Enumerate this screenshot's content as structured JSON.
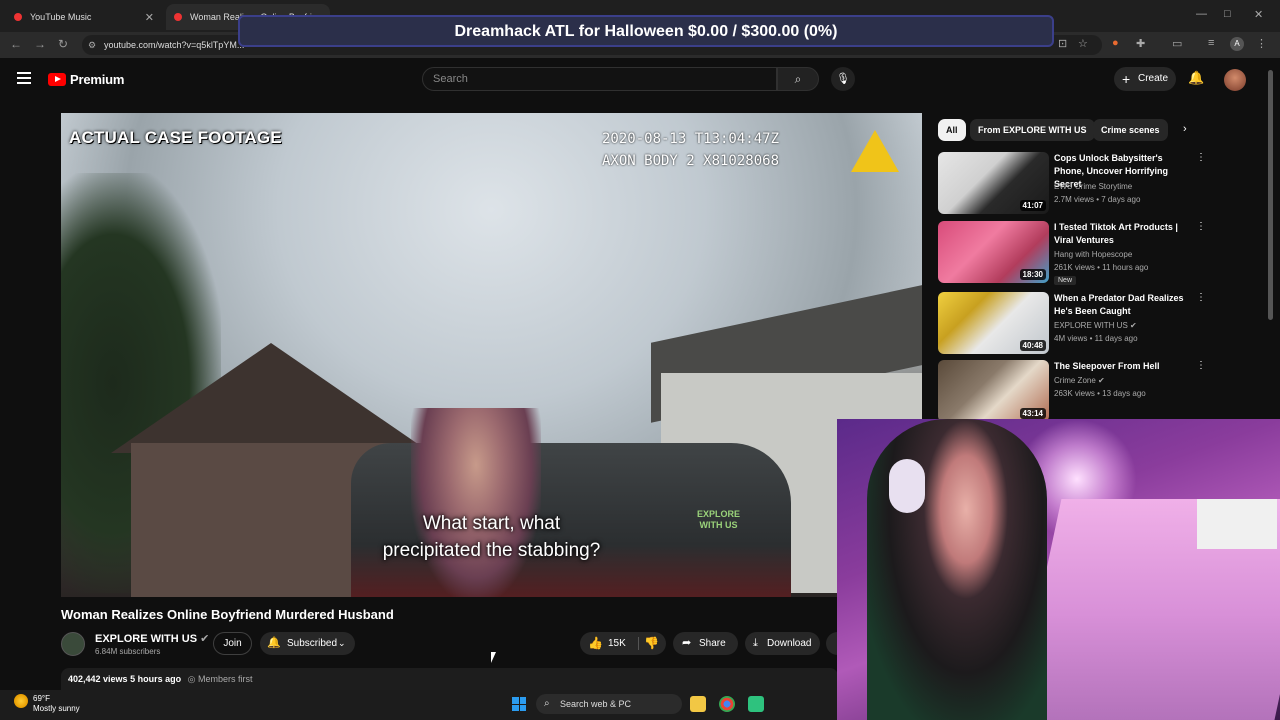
{
  "browser": {
    "tabs": [
      {
        "label": "YouTube Music"
      },
      {
        "label": "Woman Realizes Online Boyfriend Murdered Husband"
      }
    ],
    "url": "youtube.com/watch?v=q5klTpYM..."
  },
  "overlay_banner": "Dreamhack ATL for Halloween $0.00 / $300.00 (0%)",
  "yt": {
    "logo_text": "Premium",
    "search_placeholder": "Search",
    "create_label": "Create"
  },
  "player": {
    "corner_label": "ACTUAL CASE FOOTAGE",
    "timestamp_line1": "2020-08-13 T13:04:47Z",
    "timestamp_line2": "AXON BODY 2 X81028068",
    "watermark": "EXPLORE WITH US",
    "subtitle_line1": "What start, what",
    "subtitle_line2": "precipitated the stabbing?"
  },
  "video": {
    "title": "Woman Realizes Online Boyfriend Murdered Husband",
    "channel": "EXPLORE WITH US",
    "subscribers": "6.84M subscribers",
    "join_label": "Join",
    "subscribed_label": "Subscribed",
    "likes": "15K",
    "share_label": "Share",
    "download_label": "Download",
    "views": "402,442 views",
    "age": "5 hours ago",
    "members_label": "Members first"
  },
  "chips": [
    {
      "label": "All",
      "active": true
    },
    {
      "label": "From EXPLORE WITH US",
      "active": false
    },
    {
      "label": "Crime scenes",
      "active": false
    }
  ],
  "recommendations": [
    {
      "title": "Cops Unlock Babysitter's Phone, Uncover Horrifying Secret",
      "channel": "EWU Crime Storytime",
      "meta": "2.7M views • 7 days ago",
      "duration": "41:07",
      "badge": ""
    },
    {
      "title": "I Tested Tiktok Art Products | Viral Ventures",
      "channel": "Hang with Hopescope",
      "meta": "261K views • 11 hours ago",
      "duration": "18:30",
      "badge": "New"
    },
    {
      "title": "When a Predator Dad Realizes He's Been Caught",
      "channel": "EXPLORE WITH US",
      "meta": "4M views • 11 days ago",
      "duration": "40:48",
      "badge": ""
    },
    {
      "title": "The Sleepover From Hell",
      "channel": "Crime Zone",
      "meta": "263K views • 13 days ago",
      "duration": "43:14",
      "badge": ""
    }
  ],
  "taskbar": {
    "temperature": "69°F",
    "condition": "Mostly sunny",
    "search_label": "Search web & PC"
  },
  "colors": {
    "yt_red": "#ff0000",
    "background": "#0f0f0f",
    "webcam_tint": "#8a3c9c"
  }
}
